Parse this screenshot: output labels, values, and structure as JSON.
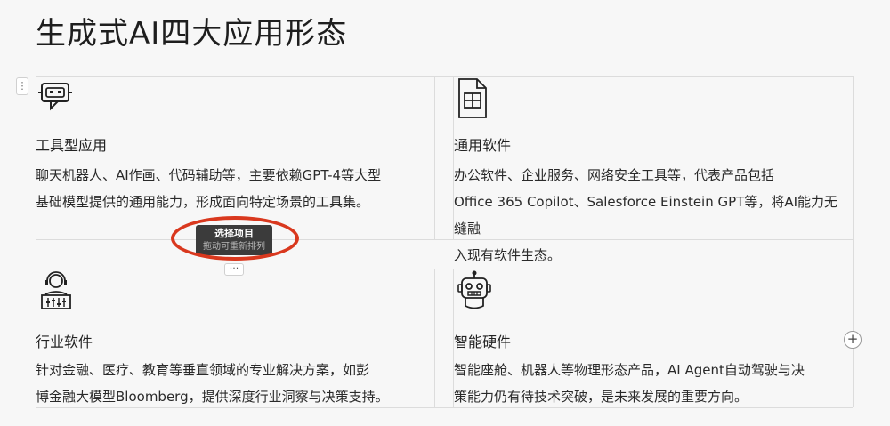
{
  "page": {
    "title": "生成式AI四大应用形态"
  },
  "cards": [
    {
      "icon": "chatbot-icon",
      "title": "工具型应用",
      "desc_lines": [
        "聊天机器人、AI作画、代码辅助等，主要依赖GPT-4等大型",
        "基础模型提供的通用能力，形成面向特定场景的工具集。"
      ]
    },
    {
      "icon": "spreadsheet-icon",
      "title": "通用软件",
      "desc_lines": [
        "办公软件、企业服务、网络安全工具等，代表产品包括",
        "Office 365 Copilot、Salesforce Einstein GPT等，将AI能力无缝融",
        "入现有软件生态。"
      ]
    },
    {
      "icon": "support-agent-icon",
      "title": "行业软件",
      "desc_lines": [
        "针对金融、医疗、教育等垂直领域的专业解决方案，如彭",
        "博金融大模型Bloomberg，提供深度行业洞察与决策支持。"
      ]
    },
    {
      "icon": "robot-icon",
      "title": "智能硬件",
      "desc_lines": [
        "智能座舱、机器人等物理形态产品，AI Agent自动驾驶与决",
        "策能力仍有待技术突破，是未来发展的重要方向。"
      ]
    }
  ],
  "tooltip": {
    "title": "选择项目",
    "subtitle": "拖动可重新排列"
  },
  "controls": {
    "drag_handle": "⋮",
    "more": "···",
    "add": "+"
  },
  "colors": {
    "annotation": "#d9381e",
    "tooltip_bg": "#3b3b3b"
  }
}
